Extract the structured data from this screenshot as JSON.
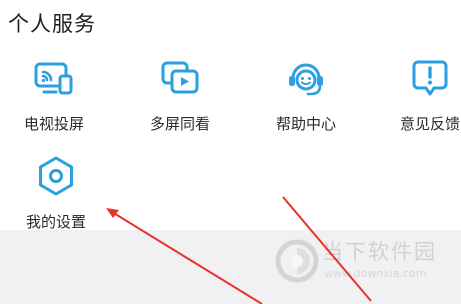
{
  "section": {
    "title": "个人服务"
  },
  "services": [
    {
      "label": "电视投屏",
      "icon": "tv-cast-icon"
    },
    {
      "label": "多屏同看",
      "icon": "multi-screen-icon"
    },
    {
      "label": "帮助中心",
      "icon": "help-headset-icon"
    },
    {
      "label": "意见反馈",
      "icon": "feedback-icon"
    },
    {
      "label": "我的设置",
      "icon": "settings-hexagon-icon"
    }
  ],
  "watermark": {
    "title": "当下软件园",
    "url": "www.downxia.com"
  },
  "colors": {
    "icon_accent": "#2b9fe0",
    "annotation_arrow": "#e8322a",
    "footer_band": "#f1f1f3"
  }
}
